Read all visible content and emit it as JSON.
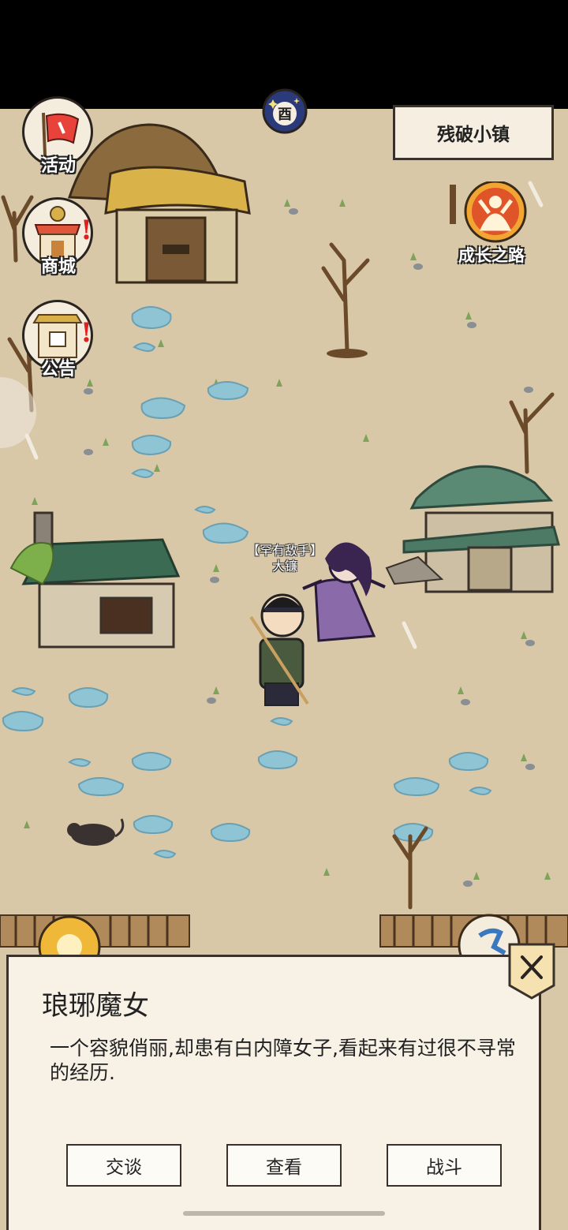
{
  "location": {
    "name": "残破小镇"
  },
  "side_menu": {
    "items": [
      {
        "label": "活动",
        "icon": "flag-icon",
        "badge": ""
      },
      {
        "label": "商城",
        "icon": "shop-icon",
        "badge": "!"
      },
      {
        "label": "公告",
        "icon": "notice-icon",
        "badge": "!"
      }
    ]
  },
  "growth_path": {
    "label": "成长之路"
  },
  "time_indicator": {
    "glyph": "酉"
  },
  "map_npc": {
    "tag_line1": "【罕有敌手】",
    "tag_line2": "大镰"
  },
  "dialog": {
    "npc_name": "琅琊魔女",
    "description": "一个容貌俏丽,却患有白内障女子,看起来有过很不寻常的经历.",
    "actions": [
      "交谈",
      "查看",
      "战斗"
    ],
    "close_icon": "close-icon"
  },
  "colors": {
    "ground": "#d8c8a8",
    "puddle": "#8ec4d4",
    "roof_green": "#3c6b54",
    "panel": "#f7f1e6",
    "badge_red": "#e02020"
  }
}
